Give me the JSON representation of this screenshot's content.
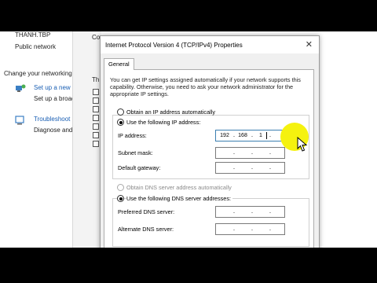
{
  "background": {
    "network_name": "THANH.TBP",
    "network_type": "Public network",
    "change_heading": "Change your networking settings",
    "items": [
      {
        "title": "Set up a new connection or network",
        "desc": "Set up a broadband, dial-up, or VPN connection"
      },
      {
        "title": "Troubleshoot problems",
        "desc": "Diagnose and repair network problems"
      }
    ],
    "panel_label_1": "Co",
    "panel_label_2": "Th"
  },
  "dialog": {
    "title": "Internet Protocol Version 4 (TCP/IPv4) Properties",
    "close_glyph": "✕",
    "tab": "General",
    "info": "You can get IP settings assigned automatically if your network supports this capability. Otherwise, you need to ask your network administrator for the appropriate IP settings.",
    "ip_auto": {
      "label": "Obtain an IP address automatically",
      "selected": false
    },
    "ip_manual": {
      "label": "Use the following IP address:",
      "selected": true
    },
    "fields": {
      "ip": {
        "label": "IP address:",
        "octets": [
          "192",
          "168",
          "1",
          ""
        ]
      },
      "subnet": {
        "label": "Subnet mask:",
        "octets": [
          "",
          "",
          "",
          ""
        ]
      },
      "gateway": {
        "label": "Default gateway:",
        "octets": [
          "",
          "",
          "",
          ""
        ]
      }
    },
    "dns_auto": {
      "label": "Obtain DNS server address automatically",
      "selected": false,
      "disabled": true
    },
    "dns_manual": {
      "label": "Use the following DNS server addresses:",
      "selected": true
    },
    "dns_fields": {
      "preferred": {
        "label": "Preferred DNS server:",
        "octets": [
          "",
          "",
          "",
          ""
        ]
      },
      "alternate": {
        "label": "Alternate DNS server:",
        "octets": [
          "",
          "",
          "",
          ""
        ]
      }
    }
  },
  "colors": {
    "highlight": "#f5f20f",
    "link": "#1a5fb4"
  }
}
